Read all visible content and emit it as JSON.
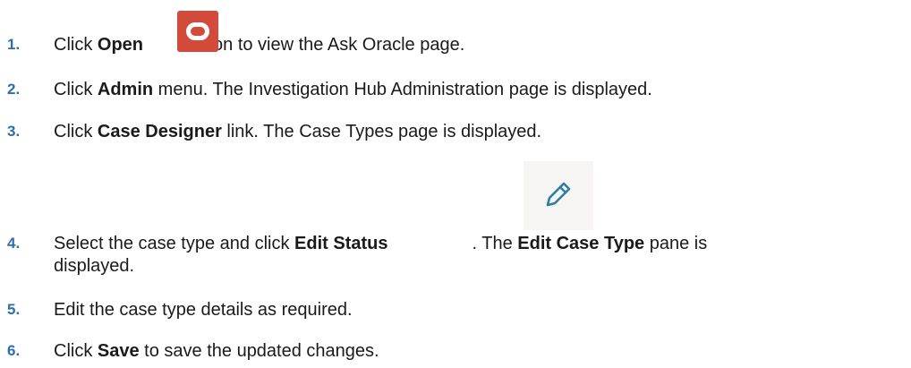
{
  "steps": [
    {
      "number": "1.",
      "before": "Click ",
      "bold": "Open",
      "after": " icon to view the Ask Oracle page."
    },
    {
      "number": "2.",
      "before": "Click ",
      "bold": "Admin",
      "after": " menu. The Investigation Hub Administration page is displayed."
    },
    {
      "number": "3.",
      "before": "Click ",
      "bold": "Case Designer",
      "after": " link. The Case Types page is displayed."
    },
    {
      "number": "4.",
      "before": "Select the case type and click ",
      "bold": "Edit Status",
      "middle": ". The ",
      "bold2": "Edit Case Type",
      "after": " pane is",
      "after_line2": "displayed."
    },
    {
      "number": "5.",
      "text": "Edit the case type details as required."
    },
    {
      "number": "6.",
      "before": "Click ",
      "bold": "Save",
      "after": " to save the updated changes."
    }
  ],
  "icons": {
    "open": "oracle-open-icon",
    "edit": "pencil-edit-icon"
  },
  "colors": {
    "step_number": "#2b6dbd",
    "open_icon_bg": "#d44a3a",
    "edit_icon": "#2a7fa8",
    "edit_icon_bg": "#f6f5f3"
  }
}
